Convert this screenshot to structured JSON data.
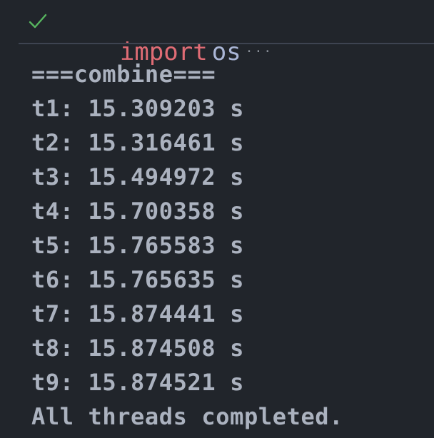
{
  "cell": {
    "status_icon": "check-icon",
    "code": {
      "keyword": "import",
      "module": "os",
      "ellipsis": "···"
    }
  },
  "output": {
    "lines": [
      "===combine===",
      "t1: 15.309203 s",
      "t2: 15.316461 s",
      "t3: 15.494972 s",
      "t4: 15.700358 s",
      "t5: 15.765583 s",
      "t6: 15.765635 s",
      "t7: 15.874441 s",
      "t8: 15.874508 s",
      "t9: 15.874521 s",
      "All threads completed."
    ]
  },
  "colors": {
    "background": "#21252b",
    "keyword": "#e06c75",
    "module": "#aab6d6",
    "check": "#57b65f",
    "output_text": "#abb2bf",
    "divider": "#3e4451"
  }
}
